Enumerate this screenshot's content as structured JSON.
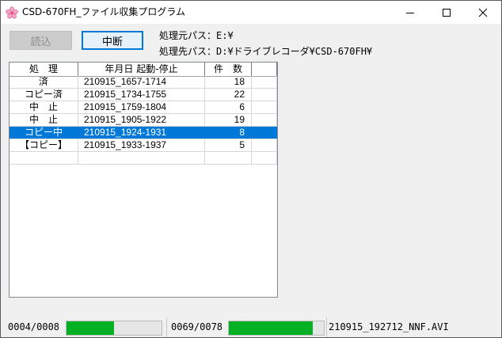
{
  "window": {
    "title": "CSD-670FH_ファイル収集プログラム",
    "app_icon": "cherry-blossom-icon",
    "controls": {
      "minimize_icon": "minimize-icon",
      "maximize_icon": "maximize-icon",
      "close_icon": "close-icon"
    }
  },
  "toolbar": {
    "load_label": "読込",
    "load_enabled": false,
    "stop_label": "中断"
  },
  "paths": {
    "source": "処理元パス：E:¥",
    "destination": "処理先パス：D:¥ドライブレコーダ¥CSD-670FH¥"
  },
  "list": {
    "columns": [
      "処　理",
      "年月日 起動-停止",
      "件　数",
      ""
    ],
    "rows": [
      {
        "status": "済",
        "range": "210915_1657-1714",
        "count": "18",
        "selected": false
      },
      {
        "status": "コピー済",
        "range": "210915_1734-1755",
        "count": "22",
        "selected": false
      },
      {
        "status": "中　止",
        "range": "210915_1759-1804",
        "count": "6",
        "selected": false
      },
      {
        "status": "中　止",
        "range": "210915_1905-1922",
        "count": "19",
        "selected": false
      },
      {
        "status": "コピー中",
        "range": "210915_1924-1931",
        "count": "8",
        "selected": true
      },
      {
        "status": "【コピー】",
        "range": "210915_1933-1937",
        "count": "5",
        "selected": false
      },
      {
        "status": "",
        "range": "",
        "count": "",
        "selected": false
      }
    ]
  },
  "status": {
    "group_counter": "0004/0008",
    "group_progress": 0.5,
    "file_counter": "0069/0078",
    "file_progress": 0.88,
    "current_file": "210915_192712_NNF.AVI",
    "progress_color": "#06b025"
  },
  "colors": {
    "selection": "#0078d7",
    "focus_border": "#0078d7"
  }
}
